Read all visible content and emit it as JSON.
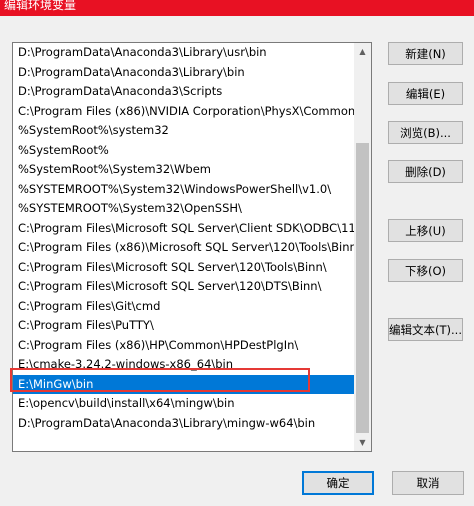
{
  "window": {
    "title": "编辑环境变量"
  },
  "path_list": {
    "items": [
      "D:\\ProgramData\\Anaconda3\\Library\\usr\\bin",
      "D:\\ProgramData\\Anaconda3\\Library\\bin",
      "D:\\ProgramData\\Anaconda3\\Scripts",
      "C:\\Program Files (x86)\\NVIDIA Corporation\\PhysX\\Common",
      "%SystemRoot%\\system32",
      "%SystemRoot%",
      "%SystemRoot%\\System32\\Wbem",
      "%SYSTEMROOT%\\System32\\WindowsPowerShell\\v1.0\\",
      "%SYSTEMROOT%\\System32\\OpenSSH\\",
      "C:\\Program Files\\Microsoft SQL Server\\Client SDK\\ODBC\\11...",
      "C:\\Program Files (x86)\\Microsoft SQL Server\\120\\Tools\\Binn\\",
      "C:\\Program Files\\Microsoft SQL Server\\120\\Tools\\Binn\\",
      "C:\\Program Files\\Microsoft SQL Server\\120\\DTS\\Binn\\",
      "C:\\Program Files\\Git\\cmd",
      "C:\\Program Files\\PuTTY\\",
      "C:\\Program Files (x86)\\HP\\Common\\HPDestPlgIn\\",
      "E:\\cmake-3.24.2-windows-x86_64\\bin",
      "E:\\MinGw\\bin",
      "E:\\opencv\\build\\install\\x64\\mingw\\bin",
      "D:\\ProgramData\\Anaconda3\\Library\\mingw-w64\\bin"
    ],
    "selected_index": 17
  },
  "buttons": {
    "new": "新建(N)",
    "edit": "编辑(E)",
    "browse": "浏览(B)...",
    "delete": "删除(D)",
    "move_up": "上移(U)",
    "move_down": "下移(O)",
    "edit_text": "编辑文本(T)...",
    "ok": "确定",
    "cancel": "取消"
  }
}
